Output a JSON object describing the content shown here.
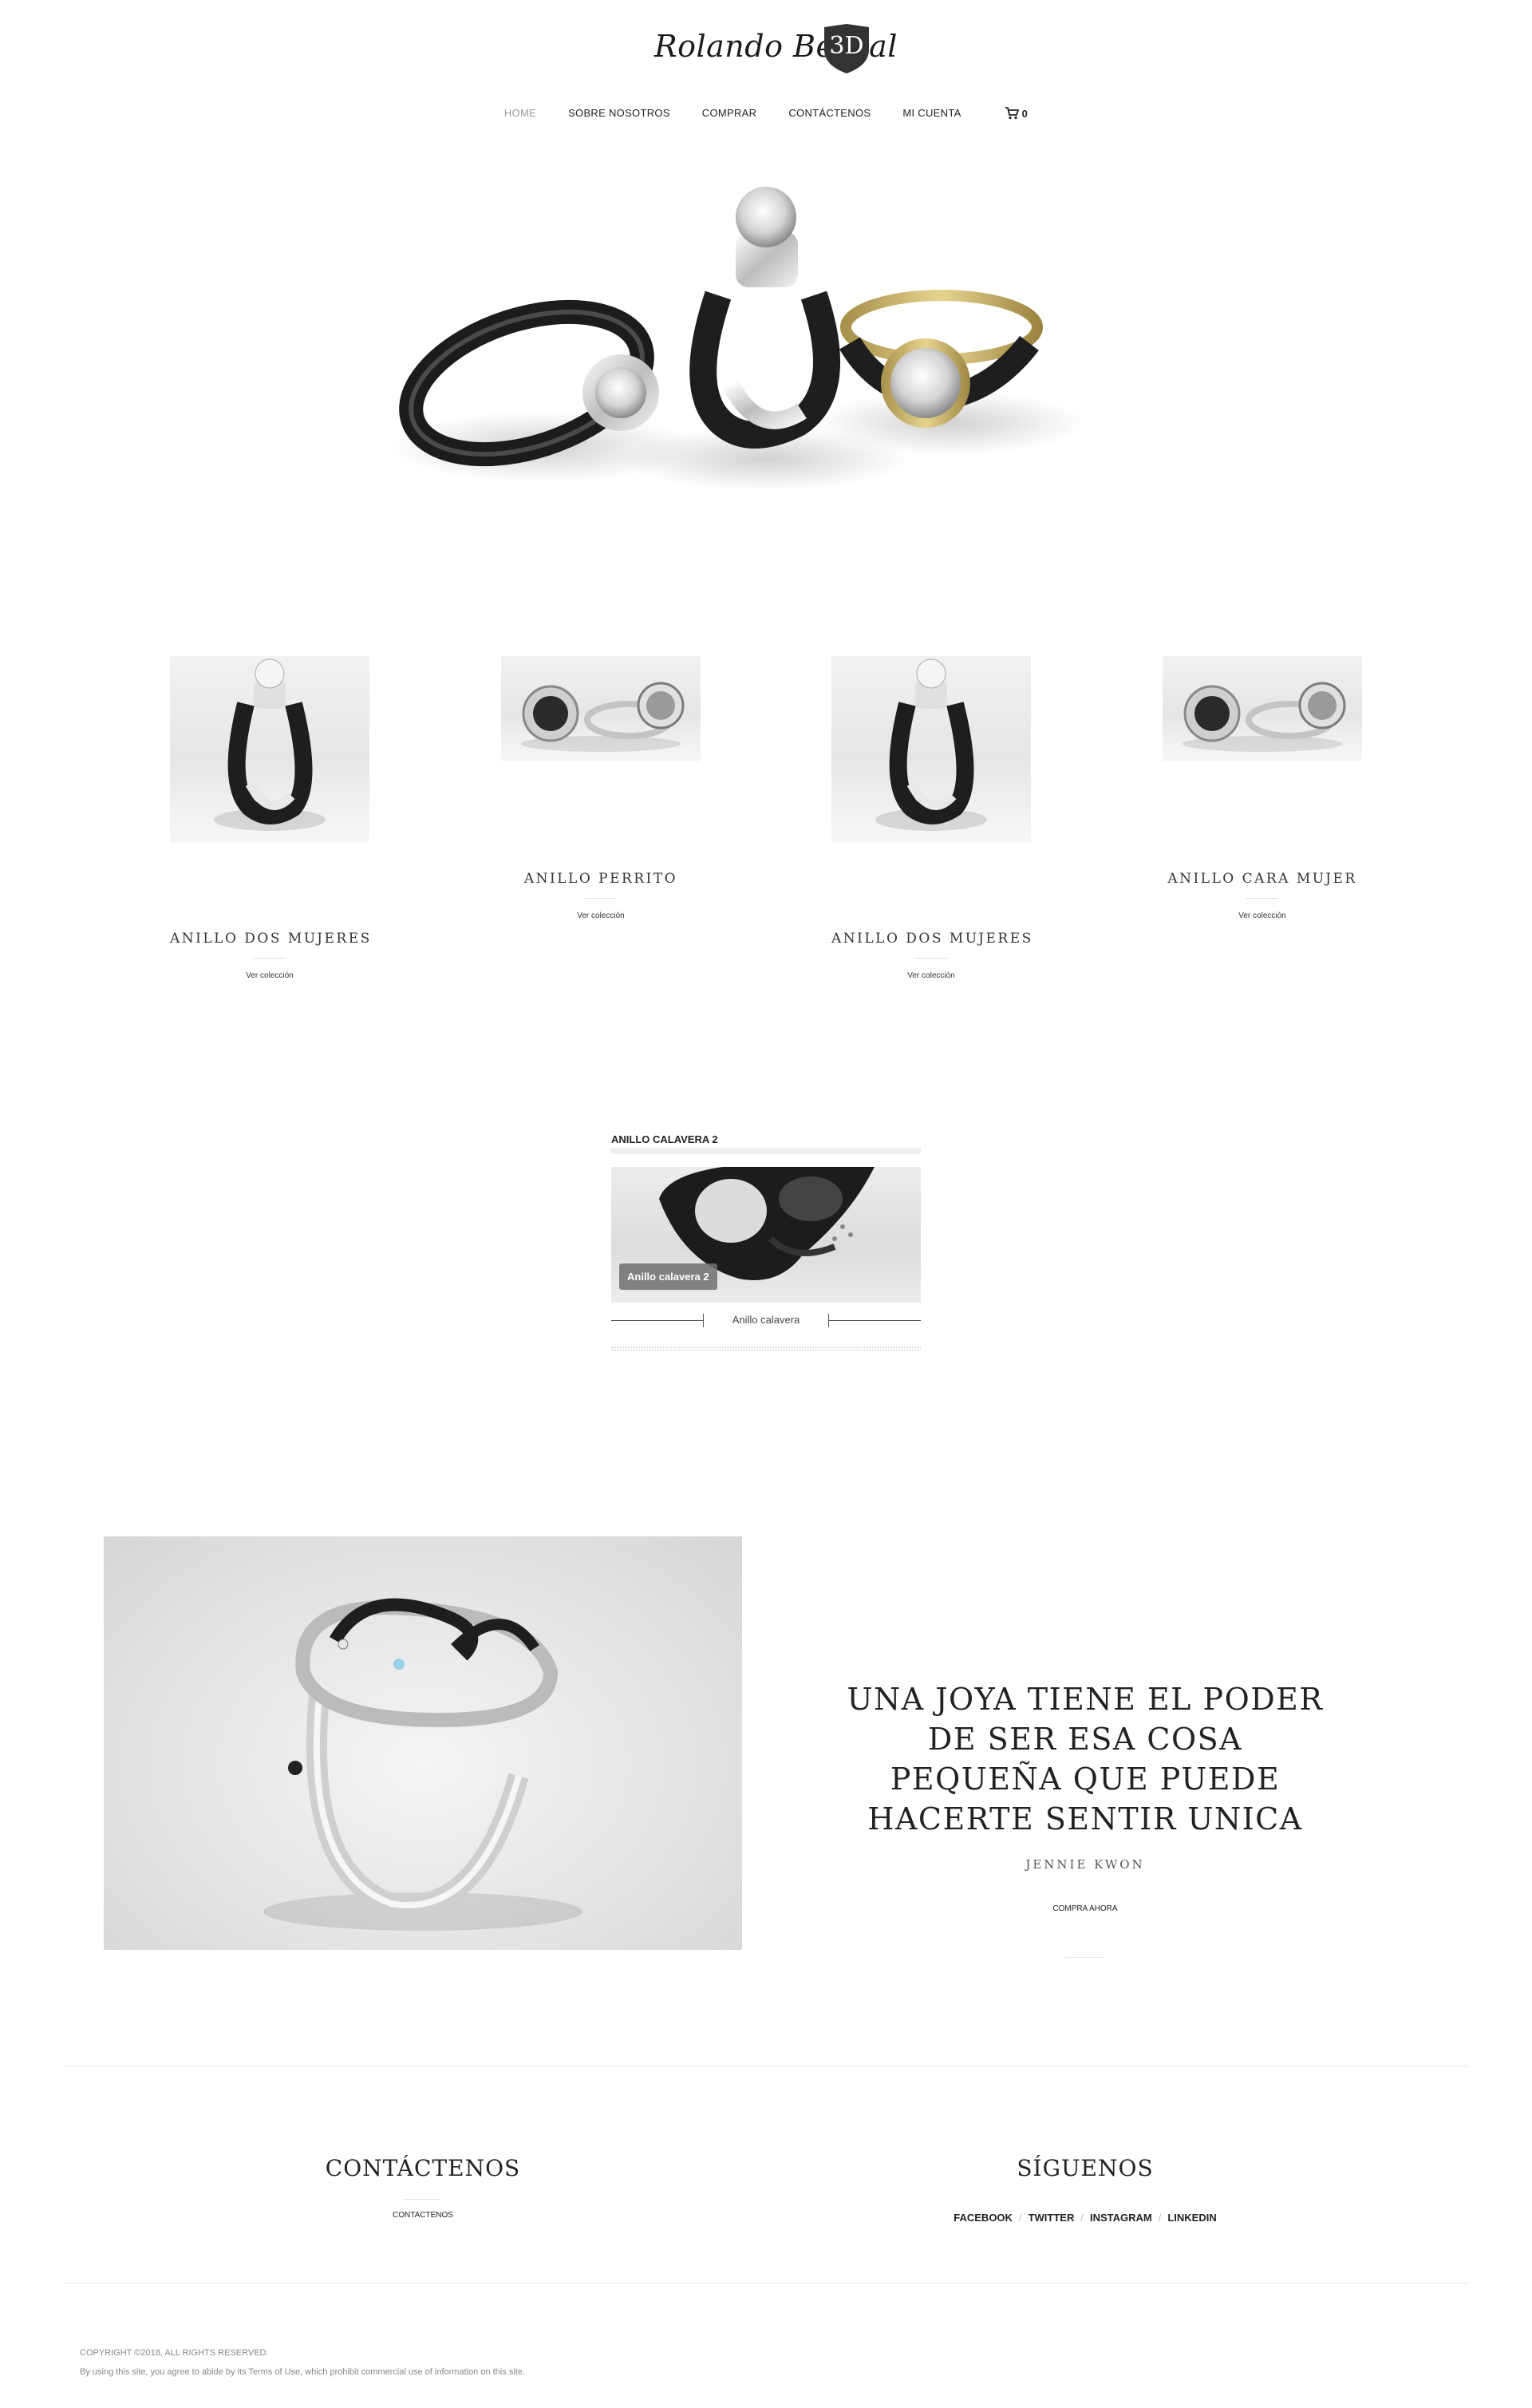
{
  "header": {
    "logo_script": "Rolando Bernal",
    "logo_mark": "3D"
  },
  "nav": {
    "items": [
      {
        "label": "HOME",
        "active": true
      },
      {
        "label": "SOBRE NOSOTROS"
      },
      {
        "label": "COMPRAR"
      },
      {
        "label": "CONTÁCTENOS"
      },
      {
        "label": "MI CUENTA"
      }
    ],
    "cart_icon": "shopping-cart-icon",
    "cart_count": "0"
  },
  "products": [
    {
      "name": "ANILLO DOS MUJERES",
      "link": "Ver colección"
    },
    {
      "name": "ANILLO PERRITO",
      "link": "Ver colección"
    },
    {
      "name": "ANILLO DOS MUJERES",
      "link": "Ver colección"
    },
    {
      "name": "ANILLO CARA MUJER",
      "link": "Ver colección"
    }
  ],
  "widget": {
    "title": "ANILLO CALAVERA 2",
    "badge": "Anillo calavera 2",
    "nav_label": "Anillo calavera"
  },
  "feature": {
    "quote": "UNA JOYA TIENE EL PODER DE SER ESA COSA PEQUEÑA QUE PUEDE HACERTE SENTIR UNICA",
    "author": "JENNIE KWON",
    "cta": "COMPRA AHORA"
  },
  "footer": {
    "contact_heading": "CONTÁCTENOS",
    "contact_link": "CONTACTENOS",
    "follow_heading": "SÍGUENOS",
    "social": [
      "FACEBOOK",
      "TWITTER",
      "INSTAGRAM",
      "LINKEDIN"
    ],
    "social_separator": "/",
    "copyright": "COPYRIGHT ©2018, ALL RIGHTS RESERVED.",
    "terms": "By using this site, you agree to abide by its Terms of Use, which prohibit commercial use of information on this site."
  },
  "colors": {
    "text": "#222222",
    "nav_active": "#9a9a9a",
    "divider": "#e6e6e6",
    "metal_dark": "#1f1f1f",
    "metal_silver": "#d8d8d8",
    "gold": "#c9b46a"
  }
}
